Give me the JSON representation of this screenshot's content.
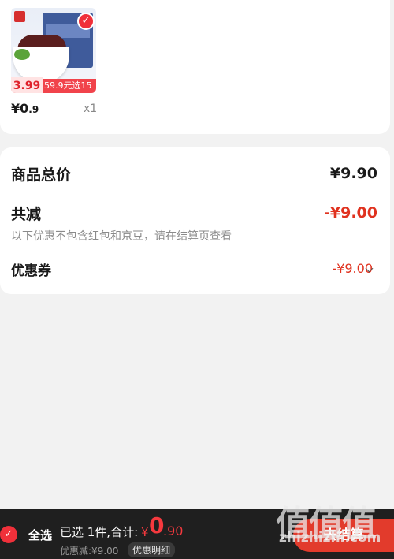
{
  "product": {
    "price_symbol": "¥",
    "price_int": "0",
    "price_dec": ".9",
    "quantity": "x1",
    "promo_price": "3.99",
    "promo_deal": "59.9元选15件"
  },
  "summary": {
    "total_label": "商品总价",
    "total_value": "¥9.90",
    "reduced_label": "共减",
    "reduced_value": "-¥9.00",
    "note": "以下优惠不包含红包和京豆，请在结算页查看",
    "coupon_label": "优惠券",
    "coupon_value": "-¥9.00"
  },
  "bottom": {
    "select_all": "全选",
    "selected": "已选 1件,合计:",
    "total_symbol": "¥",
    "total_int": "0",
    "total_dec": ".90",
    "discount": "优惠减:¥9.00",
    "detail_button": "优惠明细",
    "checkout_button": "去结算"
  },
  "watermark": {
    "main": "值值值",
    "sub": "zhizhizhi.com"
  },
  "colors": {
    "accent_red": "#f0303a",
    "reduce_red": "#e0321f",
    "bar_bg": "#1f1f1f"
  },
  "icons": [
    "check-icon",
    "chevron-down-icon"
  ]
}
